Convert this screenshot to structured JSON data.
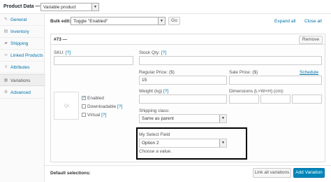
{
  "header": {
    "title": "Product Data —",
    "product_type": "Variable product"
  },
  "sidebar": {
    "items": [
      {
        "label": "General",
        "icon": "wrench-icon"
      },
      {
        "label": "Inventory",
        "icon": "clipboard-icon"
      },
      {
        "label": "Shipping",
        "icon": "truck-icon"
      },
      {
        "label": "Linked Products",
        "icon": "link-icon"
      },
      {
        "label": "Attributes",
        "icon": "list-icon"
      },
      {
        "label": "Variations",
        "icon": "grid-icon"
      },
      {
        "label": "Advanced",
        "icon": "gear-icon"
      }
    ],
    "active": "Variations"
  },
  "toolbar": {
    "bulk_label": "Bulk edit:",
    "bulk_value": "Toggle \"Enabled\"",
    "go_label": "Go",
    "expand_all": "Expand all",
    "close_all": "Close all"
  },
  "variation": {
    "number": "#73 —",
    "remove_label": "Remove",
    "sku_label": "SKU:",
    "help_mark": "[?]",
    "stock_qty_label": "Stock Qty:",
    "image_placeholder": "Qc",
    "enabled_label": "Enabled",
    "enabled_checked": true,
    "downloadable_label": "Downloadable",
    "downloadable_checked": false,
    "virtual_label": "Virtual",
    "virtual_checked": false,
    "regular_price_label": "Regular Price: ($)",
    "regular_price_value": "15",
    "sale_price_label": "Sale Price: ($)",
    "schedule_label": "Schedule",
    "weight_label": "Weight (kg)",
    "dimensions_label": "Dimensions (L×W×H) (cm):",
    "shipping_class_label": "Shipping class:",
    "shipping_class_value": "Same as parent",
    "custom_field_label": "My Select Field",
    "custom_field_value": "Option 2",
    "custom_field_hint": "Choose a value."
  },
  "footer": {
    "default_selections": "Default selections:",
    "link_all_label": "Link all variations",
    "add_variation_label": "Add Variation"
  },
  "colors": {
    "link": "#0073aa",
    "primary_button": "#0085ba"
  }
}
